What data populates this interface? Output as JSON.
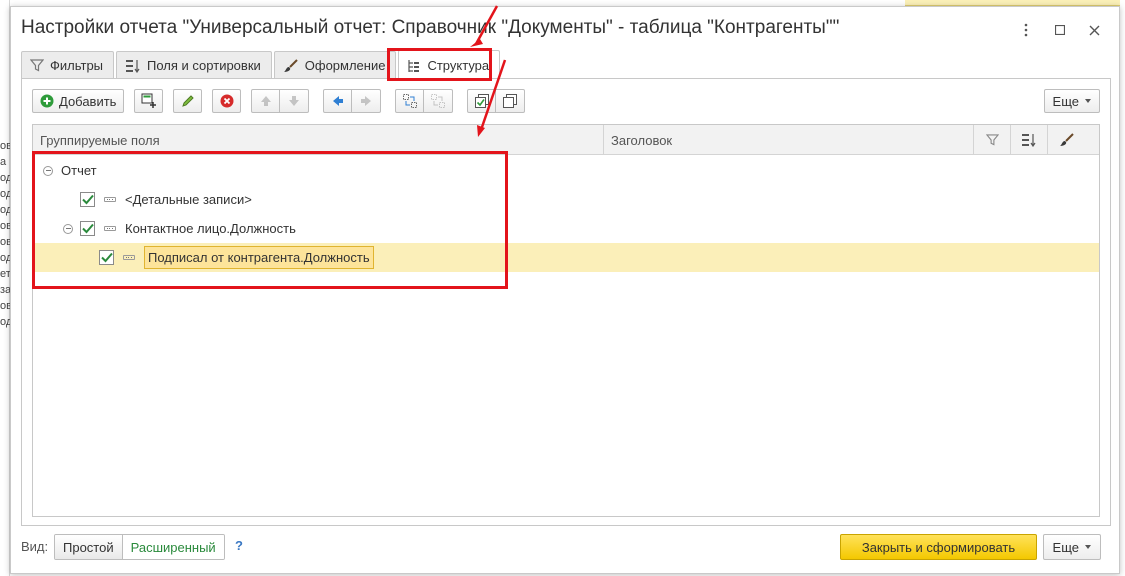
{
  "window": {
    "title": "Настройки отчета \"Универсальный отчет: Справочник \"Документы\" - таблица \"Контрагенты\"\"",
    "more_icon": "vertical-dots-icon",
    "maximize_icon": "maximize-icon",
    "close_icon": "close-icon"
  },
  "background": {
    "left_fragments": [
      "ов",
      "а",
      "од",
      "од",
      "од",
      "ов",
      "ов",
      "од",
      "ет",
      "за",
      "ов",
      "од"
    ]
  },
  "tabs": [
    {
      "label": "Фильтры",
      "icon": "filter-icon"
    },
    {
      "label": "Поля и сортировки",
      "icon": "fields-sort-icon"
    },
    {
      "label": "Оформление",
      "icon": "brush-icon"
    },
    {
      "label": "Структура",
      "icon": "structure-icon",
      "active": true
    }
  ],
  "toolbar": {
    "add_label": "Добавить",
    "more_label": "Еще"
  },
  "grid": {
    "columns": {
      "fields": "Группируемые поля",
      "header": "Заголовок"
    },
    "rows": [
      {
        "label": "Отчет",
        "level": 0
      },
      {
        "label": "<Детальные записи>",
        "level": 1,
        "checked": true
      },
      {
        "label": "Контактное лицо.Должность",
        "level": 1,
        "checked": true
      },
      {
        "label": "Подписал от контрагента.Должность",
        "level": 2,
        "checked": true,
        "selected": true
      }
    ]
  },
  "footer": {
    "view_label": "Вид:",
    "simple_label": "Простой",
    "extended_label": "Расширенный",
    "help_label": "?",
    "close_generate_label": "Закрыть и сформировать",
    "more_label": "Еще"
  },
  "colors": {
    "accent_yellow": "#f4c800",
    "selected_row": "#fbefb9",
    "annotation_red": "#e3141b",
    "check_green": "#2a8a3c"
  }
}
